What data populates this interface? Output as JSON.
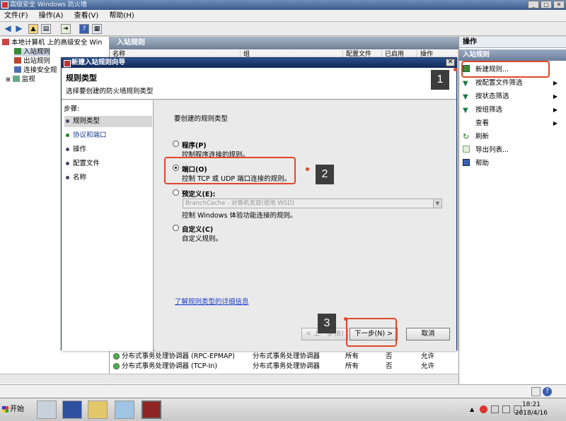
{
  "window": {
    "title": "高级安全 Windows 防火墙"
  },
  "menubar": [
    "文件(F)",
    "操作(A)",
    "查看(V)",
    "帮助(H)"
  ],
  "tree": {
    "root": "本地计算机 上的高级安全 Win",
    "items": [
      "入站规则",
      "出站规则",
      "连接安全规",
      "监视"
    ]
  },
  "center": {
    "header": "入站规则",
    "columns": [
      "名称",
      "组",
      "配置文件",
      "已启用",
      "操作"
    ],
    "rows": [
      {
        "name": "分布式事务处理协调器 (RPC-EPMAP)",
        "group": "分布式事务处理协调器",
        "profile": "所有",
        "enabled": "否",
        "action": "允许"
      },
      {
        "name": "分布式事务处理协调器 (TCP-In)",
        "group": "分布式事务处理协调器",
        "profile": "所有",
        "enabled": "否",
        "action": "允许"
      }
    ]
  },
  "actions": {
    "header": "操作",
    "section": "入站规则",
    "items": [
      {
        "label": "新建规则...",
        "icon": "new-rule-icon"
      },
      {
        "label": "按配置文件筛选",
        "icon": "filter-icon",
        "submenu": true
      },
      {
        "label": "按状态筛选",
        "icon": "filter-icon",
        "submenu": true
      },
      {
        "label": "按组筛选",
        "icon": "filter-icon",
        "submenu": true
      },
      {
        "label": "查看",
        "icon": "",
        "submenu": true
      },
      {
        "label": "刷新",
        "icon": "refresh-icon"
      },
      {
        "label": "导出列表...",
        "icon": "export-icon"
      },
      {
        "label": "帮助",
        "icon": "help-icon"
      }
    ]
  },
  "wizard": {
    "title": "新建入站规则向导",
    "heading": "规则类型",
    "subheading": "选择要创建的防火墙规则类型",
    "steps_header": "步骤:",
    "steps": [
      "规则类型",
      "协议和端口",
      "操作",
      "配置文件",
      "名称"
    ],
    "question": "要创建的规则类型",
    "options": [
      {
        "label": "程序(P)",
        "desc": "控制程序连接的规则。",
        "selected": false
      },
      {
        "label": "端口(O)",
        "desc": "控制 TCP 或 UDP 端口连接的规则。",
        "selected": true
      },
      {
        "label": "预定义(E):",
        "desc": "控制 Windows 体验功能连接的规则。",
        "selected": false
      },
      {
        "label": "自定义(C)",
        "desc": "自定义规则。",
        "selected": false
      }
    ],
    "predefined_value": "BranchCache - 对等机发现(使用 WSD)",
    "link": "了解规则类型的详细信息",
    "buttons": {
      "back": "< 上一步(B)",
      "next": "下一步(N) >",
      "cancel": "取消"
    }
  },
  "callouts": [
    "1",
    "2",
    "3"
  ],
  "taskbar": {
    "start": "开始",
    "time": "18:21",
    "date": "2018/4/16"
  },
  "colors": {
    "accent_red": "#e0472b",
    "title_blue": "#1c3a6b"
  }
}
